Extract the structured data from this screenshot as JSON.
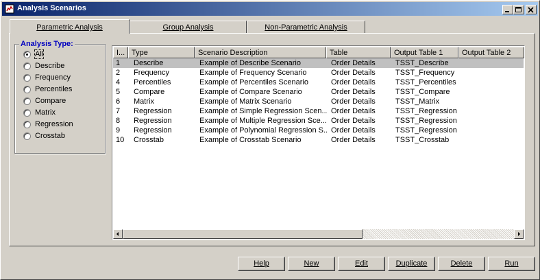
{
  "window": {
    "title": "Analysis Scenarios"
  },
  "tabs": [
    {
      "label": "Parametric Analysis",
      "active": true
    },
    {
      "label": "Group Analysis",
      "active": false
    },
    {
      "label": "Non-Parametric Analysis",
      "active": false
    }
  ],
  "analysis_type": {
    "legend": "Analysis Type:",
    "options": [
      "All",
      "Describe",
      "Frequency",
      "Percentiles",
      "Compare",
      "Matrix",
      "Regression",
      "Crosstab"
    ],
    "selected": "All"
  },
  "table": {
    "columns": [
      "I...",
      "Type",
      "Scenario Description",
      "Table",
      "Output Table 1",
      "Output Table 2"
    ],
    "rows": [
      [
        "1",
        "Describe",
        "Example of Describe Scenario",
        "Order Details",
        "TSST_Describe",
        ""
      ],
      [
        "2",
        "Frequency",
        "Example of Frequency Scenario",
        "Order Details",
        "TSST_Frequency",
        ""
      ],
      [
        "4",
        "Percentiles",
        "Example of Percentiles Scenario",
        "Order Details",
        "TSST_Percentiles",
        ""
      ],
      [
        "5",
        "Compare",
        "Example of Compare Scenario",
        "Order Details",
        "TSST_Compare",
        ""
      ],
      [
        "6",
        "Matrix",
        "Example of Matrix Scenario",
        "Order Details",
        "TSST_Matrix",
        ""
      ],
      [
        "7",
        "Regression",
        "Example of Simple Regression Scen...",
        "Order Details",
        "TSST_Regression",
        ""
      ],
      [
        "8",
        "Regression",
        "Example of Multiple Regression Sce...",
        "Order Details",
        "TSST_Regression",
        ""
      ],
      [
        "9",
        "Regression",
        "Example of Polynomial Regression S...",
        "Order Details",
        "TSST_Regression",
        ""
      ],
      [
        "10",
        "Crosstab",
        "Example of Crosstab Scenario",
        "Order Details",
        "TSST_Crosstab",
        ""
      ]
    ],
    "selected_row": 0
  },
  "buttons": [
    "Help",
    "New",
    "Edit",
    "Duplicate",
    "Delete",
    "Run"
  ],
  "colors": {
    "title_start": "#0a246a",
    "title_end": "#a6caf0",
    "legend": "#0000c0",
    "face": "#d4d0c8"
  },
  "icons": {
    "app": "app-icon",
    "minimize": "minimize-icon",
    "maximize": "maximize-icon",
    "close": "close-icon"
  }
}
